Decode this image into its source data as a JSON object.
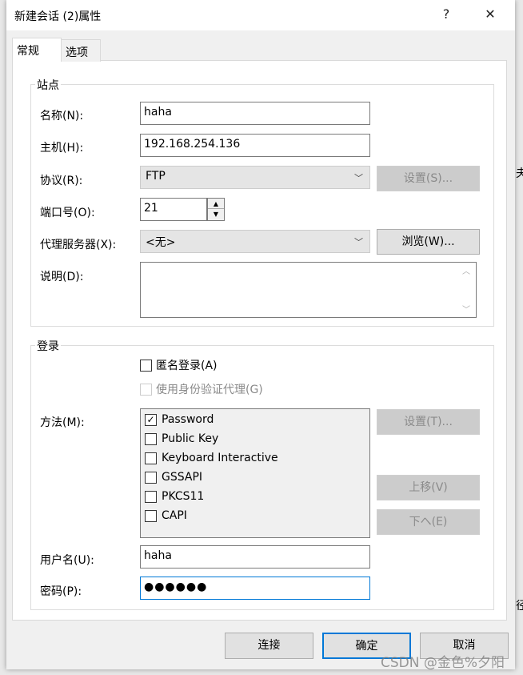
{
  "window": {
    "title": "新建会话 (2)属性",
    "help": "?",
    "close": "✕"
  },
  "tabs": [
    {
      "label": "常规",
      "active": true
    },
    {
      "label": "选项",
      "active": false
    }
  ],
  "site": {
    "group_label": "站点",
    "name_label": "名称(N):",
    "name_value": "haha",
    "host_label": "主机(H):",
    "host_value": "192.168.254.136",
    "protocol_label": "协议(R):",
    "protocol_value": "FTP",
    "protocol_settings": "设置(S)...",
    "port_label": "端口号(O):",
    "port_value": "21",
    "proxy_label": "代理服务器(X):",
    "proxy_value": "<无>",
    "proxy_browse": "浏览(W)...",
    "desc_label": "说明(D):",
    "desc_value": ""
  },
  "login": {
    "group_label": "登录",
    "anonymous": {
      "label": "匿名登录(A)",
      "checked": false
    },
    "agent": {
      "label": "使用身份验证代理(G)",
      "checked": false,
      "disabled": true
    },
    "method_label": "方法(M):",
    "methods": [
      {
        "label": "Password",
        "checked": true
      },
      {
        "label": "Public Key",
        "checked": false
      },
      {
        "label": "Keyboard Interactive",
        "checked": false
      },
      {
        "label": "GSSAPI",
        "checked": false
      },
      {
        "label": "PKCS11",
        "checked": false
      },
      {
        "label": "CAPI",
        "checked": false
      }
    ],
    "method_settings": "设置(T)...",
    "move_up": "上移(V)",
    "move_down": "下へ(E)",
    "username_label": "用户名(U):",
    "username_value": "haha",
    "password_label": "密码(P):",
    "password_value": "●●●●●●"
  },
  "footer": {
    "connect": "连接",
    "ok": "确定",
    "cancel": "取消"
  },
  "watermark": "CSDN @金色%夕阳",
  "background_fragments": [
    "夫",
    "径"
  ],
  "colors": {
    "accent": "#0078d7"
  }
}
